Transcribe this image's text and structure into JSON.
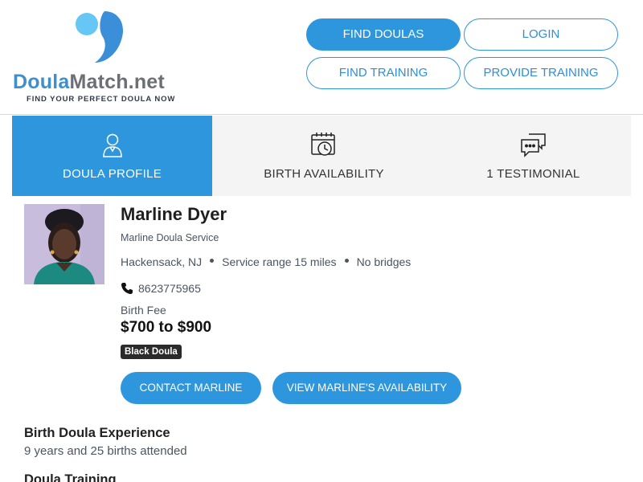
{
  "logo": {
    "name_part1": "Doula",
    "name_part2": "Match.net",
    "tagline": "FIND YOUR PERFECT DOULA NOW",
    "colors": {
      "primary": "#3f8fd0",
      "secondary": "#6c7076",
      "accent": "#5cc0f5"
    }
  },
  "nav": {
    "find_doulas": "FIND DOULAS",
    "login": "LOGIN",
    "find_training": "FIND TRAINING",
    "provide_training": "PROVIDE TRAINING"
  },
  "tabs": [
    {
      "label": "DOULA PROFILE",
      "icon": "person-icon",
      "active": true
    },
    {
      "label": "BIRTH AVAILABILITY",
      "icon": "calendar-clock-icon",
      "active": false
    },
    {
      "label": "1 TESTIMONIAL",
      "icon": "chat-bubbles-icon",
      "active": false
    }
  ],
  "profile": {
    "name": "Marline Dyer",
    "service": "Marline Doula Service",
    "location": "Hackensack, NJ",
    "service_range": "Service range 15 miles",
    "bridges": "No bridges",
    "phone": "8623775965",
    "fee_label": "Birth Fee",
    "fee_value": "$700 to $900",
    "badge": "Black Doula"
  },
  "actions": {
    "contact": "CONTACT MARLINE",
    "availability": "VIEW MARLINE'S AVAILABILITY"
  },
  "sections": {
    "experience_title": "Birth Doula Experience",
    "experience_text": "9 years and 25 births attended",
    "training_title": "Doula Training"
  },
  "colors": {
    "brand_blue": "#2e96dc",
    "tab_bg": "#f4f4f4"
  }
}
